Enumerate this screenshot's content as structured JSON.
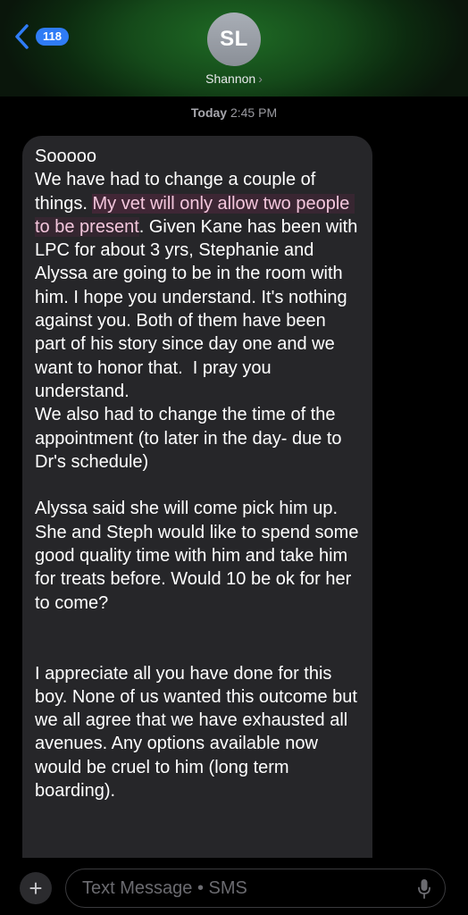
{
  "header": {
    "back_badge_count": "118",
    "avatar_initials": "SL",
    "contact_name": "Shannon",
    "contact_chevron": "›",
    "accent_color": "#1f6b25",
    "badge_color": "#2f7cf6"
  },
  "conversation": {
    "timestamp_day": "Today",
    "timestamp_time": "2:45 PM",
    "message": {
      "part1": "Sooooo\nWe have had to change a couple of things. ",
      "highlight": "My vet will only allow two people to be present",
      "part2": ". Given Kane has been with LPC for about 3 yrs, Stephanie and Alyssa are going to be in the room with him. I hope you understand. It's nothing against you. Both of them have been part of his story since day one and we want to honor that.  I pray you understand.\nWe also had to change the time of the appointment (to later in the day- due to Dr's schedule)\n\nAlyssa said she will come pick him up. She and Steph would like to spend some good quality time with him and take him for treats before. Would 10 be ok for her to come?\n\n\nI appreciate all you have done for this boy. None of us wanted this outcome but we all agree that we have exhausted all avenues. Any options available now would be cruel to him (long term boarding)."
    },
    "bubble_color": "#262629",
    "highlight_color": "#f4c7dd"
  },
  "composer": {
    "plus_label": "+",
    "placeholder": "Text Message • SMS",
    "mic_icon": "mic-icon"
  }
}
